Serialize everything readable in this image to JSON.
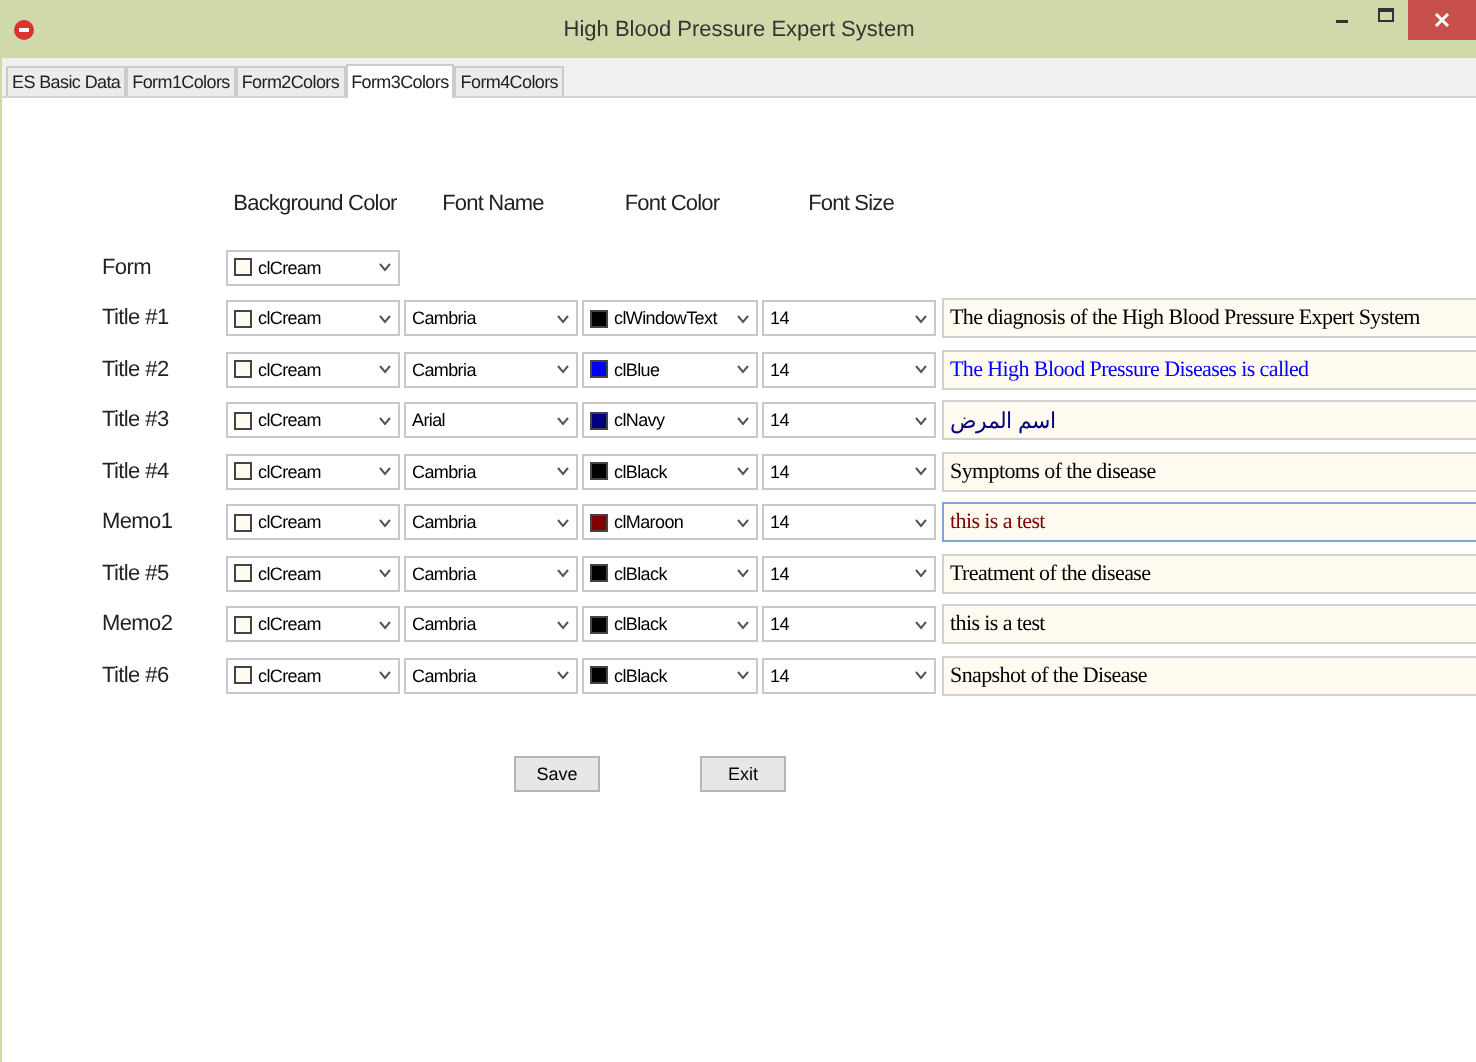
{
  "window": {
    "title": "High Blood Pressure Expert System"
  },
  "tabs": [
    {
      "label": "ES Basic Data",
      "selected": false
    },
    {
      "label": "Form1Colors",
      "selected": false
    },
    {
      "label": "Form2Colors",
      "selected": false
    },
    {
      "label": "Form3Colors",
      "selected": true
    },
    {
      "label": "Form4Colors",
      "selected": false
    }
  ],
  "columns": [
    "Background Color",
    "Font Name",
    "Font Color",
    "Font Size"
  ],
  "rows": [
    {
      "label": "Form",
      "background": {
        "name": "clCream",
        "color": "#fffbf0"
      }
    },
    {
      "label": "Title #1",
      "background": {
        "name": "clCream",
        "color": "#fffbf0"
      },
      "font": "Cambria",
      "font_color": {
        "name": "clWindowText",
        "color": "#000000"
      },
      "size": "14",
      "preview": {
        "text": "The diagnosis of the High Blood Pressure Expert System",
        "focused": false
      }
    },
    {
      "label": "Title #2",
      "background": {
        "name": "clCream",
        "color": "#fffbf0"
      },
      "font": "Cambria",
      "font_color": {
        "name": "clBlue",
        "color": "#0000ff"
      },
      "size": "14",
      "preview": {
        "text": "The High Blood Pressure Diseases is called",
        "focused": false
      }
    },
    {
      "label": "Title #3",
      "background": {
        "name": "clCream",
        "color": "#fffbf0"
      },
      "font": "Arial",
      "font_color": {
        "name": "clNavy",
        "color": "#000080"
      },
      "size": "14",
      "preview": {
        "text": "اسم المرض",
        "focused": false
      }
    },
    {
      "label": "Title #4",
      "background": {
        "name": "clCream",
        "color": "#fffbf0"
      },
      "font": "Cambria",
      "font_color": {
        "name": "clBlack",
        "color": "#000000"
      },
      "size": "14",
      "preview": {
        "text": "Symptoms of the disease",
        "focused": false
      }
    },
    {
      "label": "Memo1",
      "background": {
        "name": "clCream",
        "color": "#fffbf0"
      },
      "font": "Cambria",
      "font_color": {
        "name": "clMaroon",
        "color": "#800000"
      },
      "size": "14",
      "preview": {
        "text": "this is a test",
        "focused": true
      }
    },
    {
      "label": "Title #5",
      "background": {
        "name": "clCream",
        "color": "#fffbf0"
      },
      "font": "Cambria",
      "font_color": {
        "name": "clBlack",
        "color": "#000000"
      },
      "size": "14",
      "preview": {
        "text": "Treatment of the disease",
        "focused": false
      }
    },
    {
      "label": "Memo2",
      "background": {
        "name": "clCream",
        "color": "#fffbf0"
      },
      "font": "Cambria",
      "font_color": {
        "name": "clBlack",
        "color": "#000000"
      },
      "size": "14",
      "preview": {
        "text": "this is a test",
        "focused": false
      }
    },
    {
      "label": "Title #6",
      "background": {
        "name": "clCream",
        "color": "#fffbf0"
      },
      "font": "Cambria",
      "font_color": {
        "name": "clBlack",
        "color": "#000000"
      },
      "size": "14",
      "preview": {
        "text": "Snapshot of the Disease",
        "focused": false
      }
    }
  ],
  "buttons": [
    "Save",
    "Exit"
  ]
}
